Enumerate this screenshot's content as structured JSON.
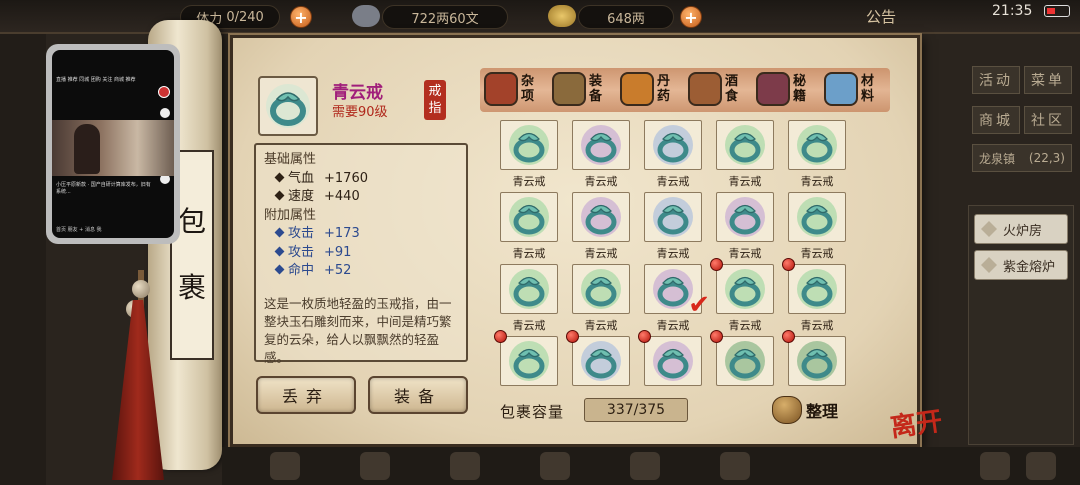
{
  "topbar": {
    "bag_count": "0/240",
    "bag_prefix": "体力",
    "copper": "722两60文",
    "silver": "648两",
    "notice": "公告",
    "time": "21:35"
  },
  "scroll_label": [
    "包",
    "裹"
  ],
  "item": {
    "name": "青云戒",
    "level_req": "需要90级",
    "type_seal": [
      "戒",
      "指"
    ],
    "base_title": "基础属性",
    "base_stats": [
      {
        "name": "气血",
        "value": "+1760"
      },
      {
        "name": "速度",
        "value": "+440"
      }
    ],
    "extra_title": "附加属性",
    "extra_stats": [
      {
        "name": "攻击",
        "value": "+173"
      },
      {
        "name": "攻击",
        "value": "+91"
      },
      {
        "name": "命中",
        "value": "+52"
      }
    ],
    "description": "这是一枚质地轻盈的玉戒指，由一整块玉石雕刻而来，中间是精巧繁复的云朵，给人以飘飘然的轻盈感。"
  },
  "buttons": {
    "discard": "丢弃",
    "equip": "装备"
  },
  "categories": [
    {
      "label": "杂项",
      "icon": "misc-pot-icon",
      "color": "#a3422a"
    },
    {
      "label": "装备",
      "icon": "equipment-weapon-icon",
      "color": "#8a6a3c"
    },
    {
      "label": "丹药",
      "icon": "pill-icon",
      "color": "#c97c2c"
    },
    {
      "label": "酒食",
      "icon": "food-jar-icon",
      "color": "#9c5d34"
    },
    {
      "label": "秘籍",
      "icon": "book-icon",
      "color": "#7d3b4a"
    },
    {
      "label": "材料",
      "icon": "crystal-icon",
      "color": "#6c9fc9"
    }
  ],
  "grid": {
    "rows": [
      [
        {
          "name": "青云戒",
          "glow": "#7fcf8a",
          "dot": false
        },
        {
          "name": "青云戒",
          "glow": "#b28ad0",
          "dot": false
        },
        {
          "name": "青云戒",
          "glow": "#8aa8e0",
          "dot": false
        },
        {
          "name": "青云戒",
          "glow": "#7fcf8a",
          "dot": false
        },
        {
          "name": "青云戒",
          "glow": "#7fcf8a",
          "dot": false
        }
      ],
      [
        {
          "name": "青云戒",
          "glow": "#7fcf8a",
          "dot": false
        },
        {
          "name": "青云戒",
          "glow": "#b28ad0",
          "dot": false
        },
        {
          "name": "青云戒",
          "glow": "#8aa8e0",
          "dot": false
        },
        {
          "name": "青云戒",
          "glow": "#b28ad0",
          "dot": false
        },
        {
          "name": "青云戒",
          "glow": "#7fcf8a",
          "dot": false
        }
      ],
      [
        {
          "name": "青云戒",
          "glow": "#7fcf8a",
          "dot": false
        },
        {
          "name": "青云戒",
          "glow": "#7fcf8a",
          "dot": false
        },
        {
          "name": "青云戒",
          "glow": "#b28ad0",
          "dot": false,
          "checked": true
        },
        {
          "name": "青云戒",
          "glow": "#7fcf8a",
          "dot": true
        },
        {
          "name": "青云戒",
          "glow": "#7fcf8a",
          "dot": true
        }
      ],
      [
        {
          "name": "",
          "glow": "#7fcf8a",
          "dot": true
        },
        {
          "name": "",
          "glow": "#8aa8e0",
          "dot": true
        },
        {
          "name": "",
          "glow": "#b28ad0",
          "dot": true
        },
        {
          "name": "",
          "glow": "#4f9a5a",
          "dot": true
        },
        {
          "name": "",
          "glow": "#4f9a5a",
          "dot": true
        }
      ]
    ]
  },
  "capacity": {
    "label": "包裹容量",
    "value": "337/375"
  },
  "sort": {
    "label": "整理"
  },
  "leave": "离开",
  "side_menu": {
    "activity": "活动",
    "menu": "菜单",
    "shop": "商城",
    "community": "社区",
    "location": "龙泉镇",
    "coords": "(22,3)",
    "items": [
      "火炉房",
      "紫金熔炉"
    ]
  },
  "phone": {
    "nav": "直播  推荐  同城  团购  关注  商城  推荐",
    "caption": "小压平原新款 · 国产自研计算库发布，旧有系统...",
    "bottom": "首页    朋友    +    消息    我"
  }
}
